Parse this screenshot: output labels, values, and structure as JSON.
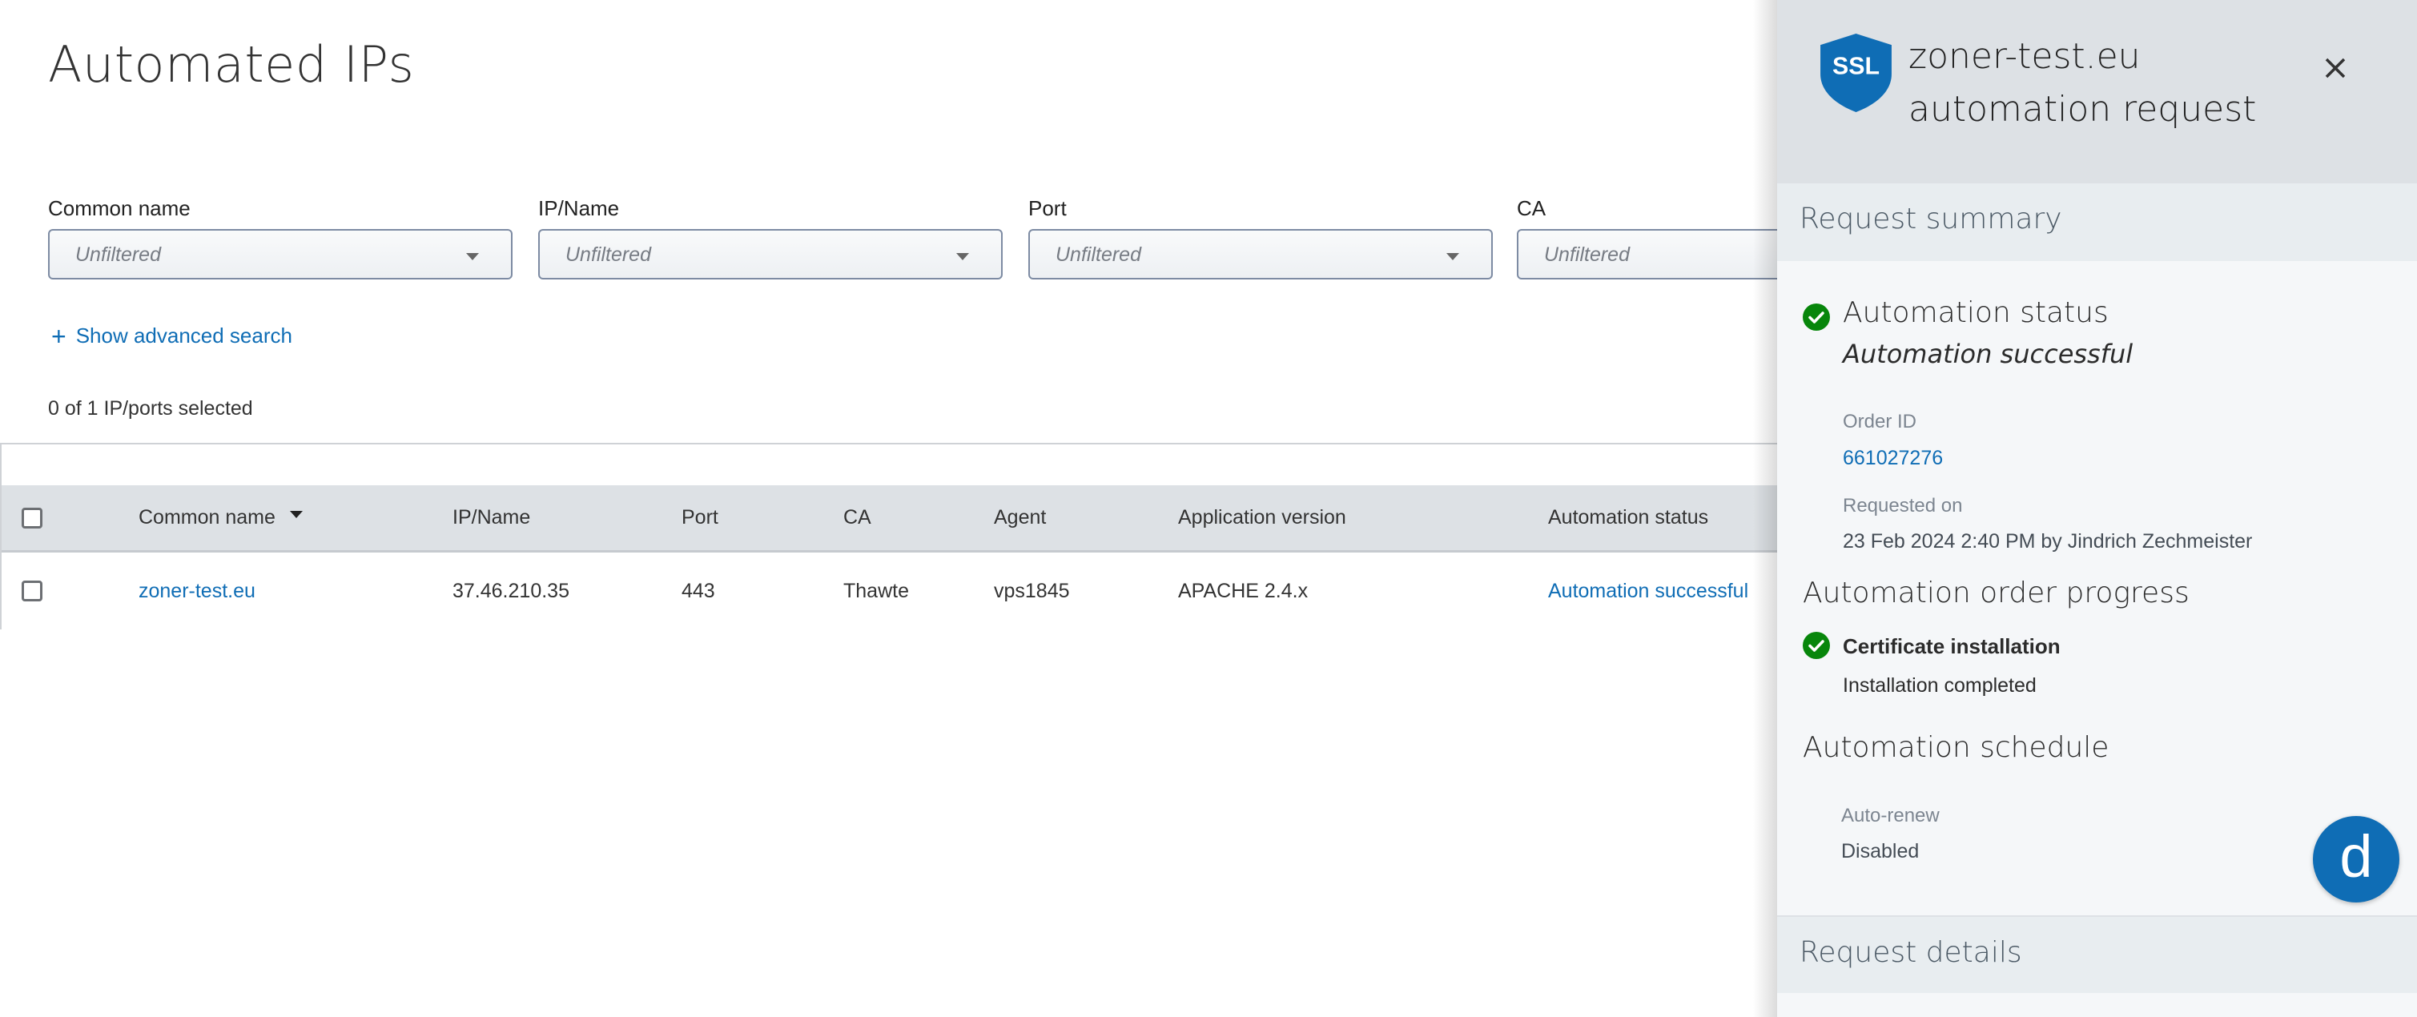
{
  "page": {
    "title": "Automated IPs"
  },
  "filters": [
    {
      "label": "Common name",
      "placeholder": "Unfiltered"
    },
    {
      "label": "IP/Name",
      "placeholder": "Unfiltered"
    },
    {
      "label": "Port",
      "placeholder": "Unfiltered"
    },
    {
      "label": "CA",
      "placeholder": "Unfiltered"
    }
  ],
  "advanced_search": {
    "icon": "plus-icon",
    "plus": "+",
    "label": "Show advanced search"
  },
  "selection_summary": "0 of 1 IP/ports selected",
  "table": {
    "sorted_column": "Common name",
    "sort_direction": "descending",
    "columns": [
      "Common name",
      "IP/Name",
      "Port",
      "CA",
      "Agent",
      "Application version",
      "Automation status"
    ],
    "rows": [
      {
        "common_name": "zoner-test.eu",
        "ip_name": "37.46.210.35",
        "port": "443",
        "ca": "Thawte",
        "agent": "vps1845",
        "application_version": "APACHE 2.4.x",
        "automation_status": "Automation successful",
        "selected": false
      }
    ]
  },
  "panel": {
    "icon": "ssl-shield-icon",
    "icon_text": "SSL",
    "title_line1": "zoner-test.eu",
    "title_line2": "automation request",
    "close_icon": "close-icon",
    "request_summary": {
      "heading": "Request summary",
      "automation_status": {
        "title": "Automation status",
        "value": "Automation successful",
        "icon": "check-circle-icon"
      },
      "order_id_label": "Order ID",
      "order_id": "661027276",
      "requested_on_label": "Requested on",
      "requested_on": "23 Feb 2024 2:40 PM by Jindrich Zechmeister"
    },
    "order_progress": {
      "heading": "Automation order progress",
      "steps": [
        {
          "title": "Certificate installation",
          "detail": "Installation completed",
          "icon": "check-circle-icon"
        }
      ]
    },
    "schedule": {
      "heading": "Automation schedule",
      "auto_renew_label": "Auto-renew",
      "auto_renew_value": "Disabled"
    },
    "request_details": {
      "heading": "Request details"
    }
  },
  "chat_button": {
    "label": "d",
    "icon": "chat-launcher-icon"
  },
  "colors": {
    "accent": "#0f6db5",
    "success": "#07860b",
    "panel_header": "#dde1e5",
    "table_header": "#dde1e5"
  }
}
